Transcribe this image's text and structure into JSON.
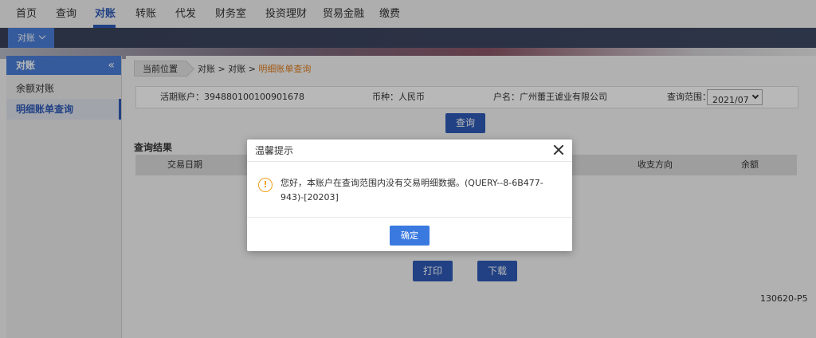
{
  "topnav": {
    "items": [
      "首页",
      "查询",
      "对账",
      "转账",
      "代发",
      "财务室",
      "投资理财",
      "贸易金融",
      "缴费"
    ],
    "active_index": 2
  },
  "subnav": {
    "tab_label": "对账"
  },
  "sidebar": {
    "title": "对账",
    "collapse_icon": "«",
    "items": [
      "余额对账",
      "明细账单查询"
    ],
    "active_index": 1
  },
  "breadcrumb": {
    "label": "当前位置",
    "path": "对账 > 对账 > ",
    "current": "明细账单查询"
  },
  "info": {
    "account": "活期账户：394880100100901678",
    "currency": "币种：人民币",
    "name": "户名：广州蕾王谑业有限公司",
    "period_label": "查询范围：",
    "period_value": "2021/07"
  },
  "query_button": "查询",
  "results": {
    "title": "查询结果",
    "columns": [
      "交易日期",
      "收支方向",
      "余额"
    ]
  },
  "print_button": "打印",
  "download_button": "下载",
  "page_code": "130620-P5",
  "modal": {
    "title": "温馨提示",
    "message": "您好，本账户在查询范围内没有交易明细数据。(QUERY--8-6B477-943)-[20203]",
    "ok": "确定",
    "warn_icon": "!"
  },
  "colors": {
    "primary": "#2f5bb7",
    "accent": "#4a7fd8",
    "warning": "#f0a020",
    "breadcrumb_current": "#e07d1e"
  }
}
